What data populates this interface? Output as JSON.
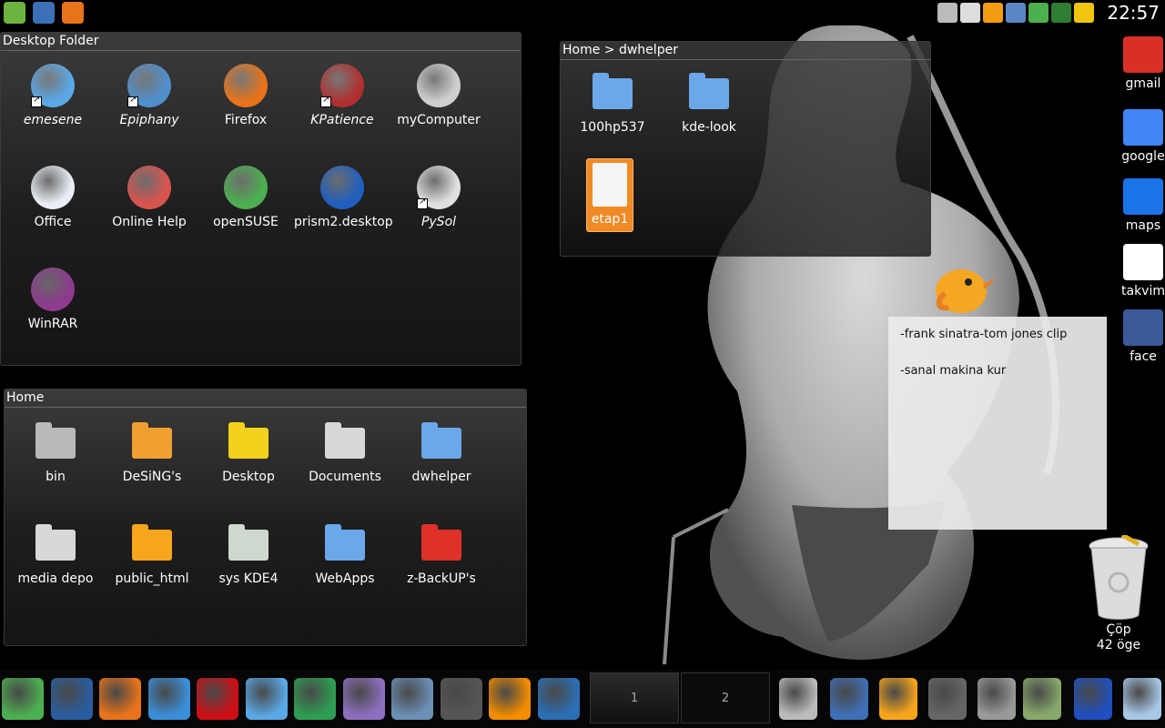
{
  "top_panel": {
    "launchers": [
      {
        "icon": "opensuse-icon",
        "color": "#6db33f"
      },
      {
        "icon": "desktop-icon",
        "color": "#3b6fb6"
      },
      {
        "icon": "firefox-icon",
        "color": "#e8731a"
      }
    ],
    "tray": [
      {
        "icon": "volume-icon",
        "color": "#bbbbbb"
      },
      {
        "icon": "clipboard-icon",
        "color": "#dddddd"
      },
      {
        "icon": "weather-icon",
        "color": "#f39c12"
      },
      {
        "icon": "network-icon",
        "color": "#5b87c7"
      },
      {
        "icon": "update-icon",
        "color": "#4caf50"
      },
      {
        "icon": "kopete-icon",
        "color": "#2e7d32"
      },
      {
        "icon": "power-icon",
        "color": "#f1c40f"
      }
    ],
    "clock": "22:57"
  },
  "desktop_folder": {
    "title": "Desktop Folder",
    "items": [
      {
        "label": "emesene",
        "icon": "emesene-icon",
        "italic": true,
        "link": true,
        "color": "#5aa8e6"
      },
      {
        "label": "Epiphany",
        "icon": "epiphany-icon",
        "italic": true,
        "link": true,
        "color": "#4f8fcc"
      },
      {
        "label": "Firefox",
        "icon": "firefox-icon",
        "italic": false,
        "link": false,
        "color": "#e8731a"
      },
      {
        "label": "KPatience",
        "icon": "kpatience-icon",
        "italic": true,
        "link": true,
        "color": "#b03030"
      },
      {
        "label": "myComputer",
        "icon": "computer-icon",
        "italic": false,
        "link": false,
        "color": "#cfcfcf"
      },
      {
        "label": "Office",
        "icon": "office-icon",
        "italic": false,
        "link": false,
        "color": "#e9eef5"
      },
      {
        "label": "Online Help",
        "icon": "help-icon",
        "italic": false,
        "link": false,
        "color": "#d9544f"
      },
      {
        "label": "openSUSE",
        "icon": "opensuse-icon",
        "italic": false,
        "link": false,
        "color": "#4caf50"
      },
      {
        "label": "prism2.desktop",
        "icon": "prism-icon",
        "italic": false,
        "link": false,
        "color": "#1f5fbf"
      },
      {
        "label": "PySol",
        "icon": "pysol-icon",
        "italic": true,
        "link": true,
        "color": "#e0e0e0"
      },
      {
        "label": "WinRAR",
        "icon": "winrar-icon",
        "italic": false,
        "link": false,
        "color": "#8e3a8e"
      }
    ]
  },
  "home_folder": {
    "title": "Home",
    "items": [
      {
        "label": "bin",
        "icon": "bin-folder-icon",
        "color": "#b9b9b9"
      },
      {
        "label": "DeSiNG's",
        "icon": "gimp-folder-icon",
        "color": "#f0a030"
      },
      {
        "label": "Desktop",
        "icon": "desktop-folder-icon",
        "color": "#f2d21b"
      },
      {
        "label": "Documents",
        "icon": "documents-folder-icon",
        "color": "#d8d8d8"
      },
      {
        "label": "dwhelper",
        "icon": "folder-icon",
        "color": "#6aa8ea"
      },
      {
        "label": "media depo",
        "icon": "media-folder-icon",
        "color": "#d8d8d8"
      },
      {
        "label": "public_html",
        "icon": "public-folder-icon",
        "color": "#f7a51c"
      },
      {
        "label": "sys KDE4",
        "icon": "opensuse-folder-icon",
        "color": "#cfd8cf"
      },
      {
        "label": "WebApps",
        "icon": "folder-icon",
        "color": "#6aa8ea"
      },
      {
        "label": "z-BackUP's",
        "icon": "recycle-folder-icon",
        "color": "#e0302a"
      }
    ]
  },
  "dwhelper_folder": {
    "title": "Home > dwhelper",
    "items": [
      {
        "label": "100hp537",
        "icon": "folder-icon",
        "color": "#6aa8ea"
      },
      {
        "label": "kde-look",
        "icon": "folder-icon",
        "color": "#6aa8ea"
      },
      {
        "label": "etap1",
        "icon": "document-icon",
        "color": "#f5f5f5",
        "selected": true
      }
    ]
  },
  "web_apps": [
    {
      "label": "gmail",
      "icon": "gmail-icon",
      "color": "#d93025"
    },
    {
      "label": "google",
      "icon": "google-icon",
      "color": "#4285f4"
    },
    {
      "label": "maps",
      "icon": "google-earth-icon",
      "color": "#1a73e8"
    },
    {
      "label": "takvim",
      "icon": "calendar-icon",
      "color": "#ffffff"
    },
    {
      "label": "face",
      "icon": "facebook-icon",
      "color": "#3b5998"
    }
  ],
  "note": {
    "lines": [
      "-frank sinatra-tom jones clip",
      "-sanal makina kur"
    ]
  },
  "trash": {
    "label": "Çöp",
    "count": "42 öge"
  },
  "taskbar": {
    "launchers": [
      {
        "icon": "opensuse-icon",
        "color": "#4caf50"
      },
      {
        "icon": "desktop-icon",
        "color": "#2a5d9f"
      },
      {
        "icon": "firefox-icon",
        "color": "#e8731a"
      },
      {
        "icon": "konqueror-icon",
        "color": "#3b8fd9"
      },
      {
        "icon": "opera-icon",
        "color": "#cc0f16"
      },
      {
        "icon": "emesene-icon",
        "color": "#5aa8e6"
      },
      {
        "icon": "bird-icon",
        "color": "#2e9e52"
      },
      {
        "icon": "pidgin-icon",
        "color": "#8e6fbf"
      },
      {
        "icon": "contacts-icon",
        "color": "#6b8fb5"
      },
      {
        "icon": "video-editor-icon",
        "color": "#555555"
      },
      {
        "icon": "vlc-icon",
        "color": "#f28c00"
      },
      {
        "icon": "amarok-icon",
        "color": "#2b6fb5"
      }
    ],
    "desktops": [
      "1",
      "2"
    ],
    "right_launchers": [
      {
        "icon": "computer-icon",
        "color": "#bbbbbb"
      },
      {
        "icon": "home-icon",
        "color": "#3f6fb6"
      },
      {
        "icon": "downloads-folder-icon",
        "color": "#f7a51c"
      },
      {
        "icon": "system-monitor-icon",
        "color": "#666666"
      },
      {
        "icon": "tools-icon",
        "color": "#999999"
      },
      {
        "icon": "settings-icon",
        "color": "#88a96b"
      },
      {
        "icon": "chart-icon",
        "color": "#1f4fbf"
      },
      {
        "icon": "laptop-icon",
        "color": "#a8c7e8"
      }
    ]
  }
}
